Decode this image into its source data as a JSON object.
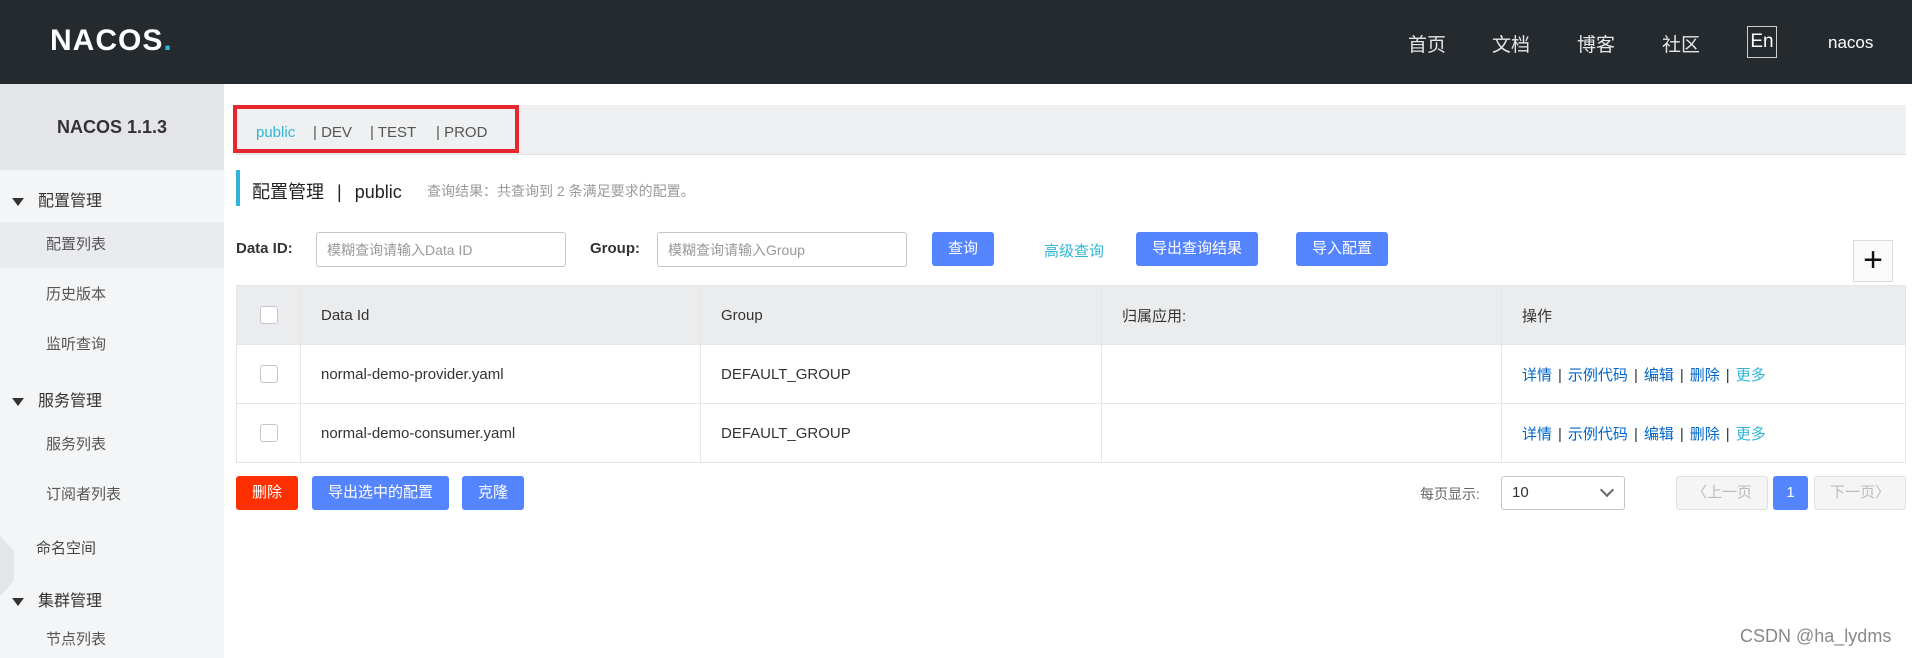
{
  "header": {
    "logo": "NACOS",
    "logo_dot": ".",
    "nav": [
      "首页",
      "文档",
      "博客",
      "社区"
    ],
    "lang": "En",
    "user": "nacos"
  },
  "sidebar": {
    "version": "NACOS 1.1.3",
    "groups": [
      {
        "label": "配置管理",
        "items": [
          "配置列表",
          "历史版本",
          "监听查询"
        ]
      },
      {
        "label": "服务管理",
        "items": [
          "服务列表",
          "订阅者列表"
        ]
      },
      {
        "label": "集群管理",
        "items": [
          "节点列表"
        ]
      }
    ],
    "namespace": "命名空间"
  },
  "namespaces": {
    "tabs": [
      "public",
      "| DEV",
      "| TEST",
      "| PROD"
    ],
    "active": "public"
  },
  "page": {
    "title": "配置管理",
    "title_sep": "|",
    "namespace": "public",
    "result": "查询结果：共查询到 2 条满足要求的配置。"
  },
  "search": {
    "dataid_label": "Data ID:",
    "dataid_placeholder": "模糊查询请输入Data ID",
    "group_label": "Group:",
    "group_placeholder": "模糊查询请输入Group",
    "query_button": "查询",
    "advanced_link": "高级查询",
    "export_button": "导出查询结果",
    "import_button": "导入配置",
    "add_symbol": "+"
  },
  "table": {
    "columns": [
      "Data Id",
      "Group",
      "归属应用:",
      "操作"
    ],
    "rows": [
      {
        "data_id": "normal-demo-provider.yaml",
        "group": "DEFAULT_GROUP",
        "app": ""
      },
      {
        "data_id": "normal-demo-consumer.yaml",
        "group": "DEFAULT_GROUP",
        "app": ""
      }
    ],
    "ops": [
      "详情",
      "示例代码",
      "编辑",
      "删除",
      "更多"
    ]
  },
  "footer": {
    "delete_button": "删除",
    "export_selected_button": "导出选中的配置",
    "clone_button": "克隆",
    "per_page_label": "每页显示:",
    "per_page_value": "10",
    "prev": "上一页",
    "current_page": "1",
    "next": "下一页"
  },
  "watermark": "CSDN @ha_lydms",
  "colors": {
    "header_bg": "#252a2f",
    "accent": "#2fb6d9",
    "primary": "#5584ff",
    "danger": "#ff3000",
    "highlight": "#e8262d"
  }
}
